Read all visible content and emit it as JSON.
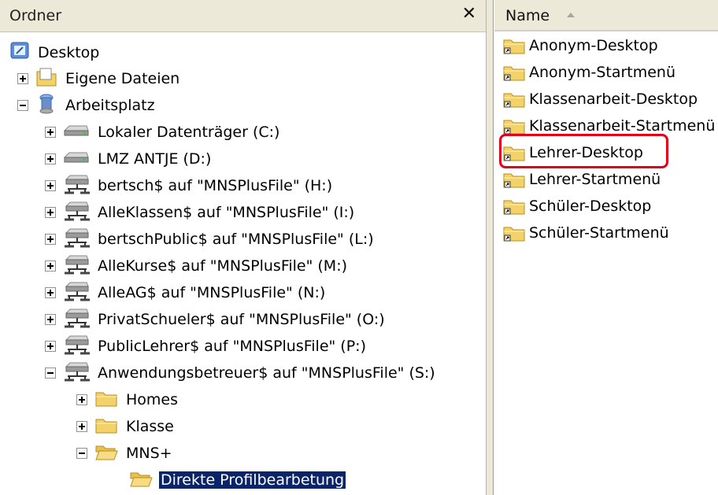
{
  "folder_pane": {
    "title": "Ordner",
    "close_label": "✕",
    "tree": [
      {
        "label": "Desktop"
      },
      {
        "label": "Eigene Dateien"
      },
      {
        "label": "Arbeitsplatz"
      },
      {
        "label": "Lokaler Datenträger (C:)"
      },
      {
        "label": "LMZ ANTJE (D:)"
      },
      {
        "label": "bertsch$ auf \"MNSPlusFile\" (H:)"
      },
      {
        "label": "AlleKlassen$ auf \"MNSPlusFile\" (I:)"
      },
      {
        "label": "bertschPublic$ auf \"MNSPlusFile\" (L:)"
      },
      {
        "label": "AlleKurse$ auf \"MNSPlusFile\" (M:)"
      },
      {
        "label": "AlleAG$ auf \"MNSPlusFile\" (N:)"
      },
      {
        "label": "PrivatSchueler$ auf \"MNSPlusFile\" (O:)"
      },
      {
        "label": "PublicLehrer$ auf \"MNSPlusFile\" (P:)"
      },
      {
        "label": "Anwendungsbetreuer$ auf \"MNSPlusFile\" (S:)"
      },
      {
        "label": "Homes"
      },
      {
        "label": "Klasse"
      },
      {
        "label": "MNS+"
      },
      {
        "label": "Direkte Profilbearbetung"
      }
    ]
  },
  "list_pane": {
    "column_header": "Name",
    "items": [
      "Anonym-Desktop",
      "Anonym-Startmenü",
      "Klassenarbeit-Desktop",
      "Klassenarbeit-Startmenü",
      "Lehrer-Desktop",
      "Lehrer-Startmenü",
      "Schüler-Desktop",
      "Schüler-Startmenü"
    ],
    "highlighted_item": "Lehrer-Desktop",
    "highlight_color": "#e0001a"
  },
  "colors": {
    "selection_bg": "#0a246a",
    "header_bg": "#ece9d8",
    "folder_yellow": "#f4d26a"
  }
}
